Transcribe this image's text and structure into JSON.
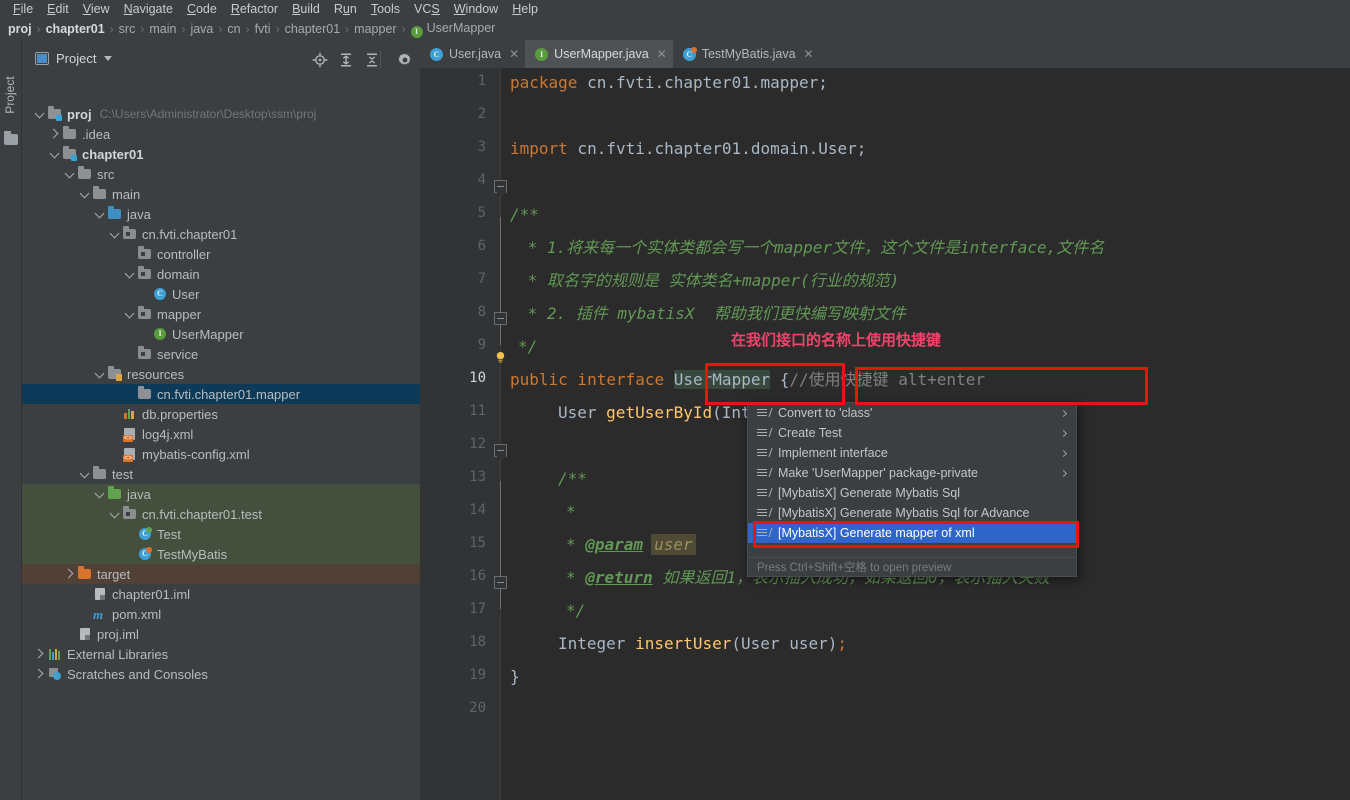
{
  "menubar": {
    "items": [
      {
        "label": "File",
        "mnemonic": "F"
      },
      {
        "label": "Edit",
        "mnemonic": "E"
      },
      {
        "label": "View",
        "mnemonic": "V"
      },
      {
        "label": "Navigate",
        "mnemonic": "N"
      },
      {
        "label": "Code",
        "mnemonic": "C"
      },
      {
        "label": "Refactor",
        "mnemonic": "R"
      },
      {
        "label": "Build",
        "mnemonic": "B"
      },
      {
        "label": "Run",
        "mnemonic": "u"
      },
      {
        "label": "Tools",
        "mnemonic": "T"
      },
      {
        "label": "VCS",
        "mnemonic": "S"
      },
      {
        "label": "Window",
        "mnemonic": "W"
      },
      {
        "label": "Help",
        "mnemonic": "H"
      }
    ]
  },
  "breadcrumb": {
    "items": [
      {
        "label": "proj",
        "bold": true,
        "icon": null
      },
      {
        "label": "chapter01",
        "bold": true,
        "icon": null
      },
      {
        "label": "src",
        "bold": false,
        "icon": null
      },
      {
        "label": "main",
        "bold": false,
        "icon": null
      },
      {
        "label": "java",
        "bold": false,
        "icon": null
      },
      {
        "label": "cn",
        "bold": false,
        "icon": null
      },
      {
        "label": "fvti",
        "bold": false,
        "icon": null
      },
      {
        "label": "chapter01",
        "bold": false,
        "icon": null
      },
      {
        "label": "mapper",
        "bold": false,
        "icon": null
      },
      {
        "label": "UserMapper",
        "bold": false,
        "icon": "interface-icon"
      }
    ],
    "separator": "›"
  },
  "left_strip": {
    "tab_label": "Project"
  },
  "project_panel": {
    "title": "Project",
    "toolbar": [
      {
        "name": "locate-file-icon"
      },
      {
        "name": "expand-all-icon"
      },
      {
        "name": "collapse-all-icon"
      },
      {
        "name": "settings-gear-icon"
      },
      {
        "name": "hide-panel-icon"
      }
    ],
    "tree": [
      {
        "indent": 0,
        "chev": "down",
        "icon": "module-folder",
        "label": "proj",
        "bold": true,
        "path": "C:\\Users\\Administrator\\Desktop\\ssm\\proj",
        "state": "normal"
      },
      {
        "indent": 1,
        "chev": "right",
        "icon": "folder-grey",
        "label": ".idea",
        "bold": false,
        "path": "",
        "state": "normal"
      },
      {
        "indent": 1,
        "chev": "down",
        "icon": "module-folder",
        "label": "chapter01",
        "bold": true,
        "path": "",
        "state": "normal"
      },
      {
        "indent": 2,
        "chev": "down",
        "icon": "folder-grey",
        "label": "src",
        "bold": false,
        "path": "",
        "state": "normal"
      },
      {
        "indent": 3,
        "chev": "down",
        "icon": "folder-grey",
        "label": "main",
        "bold": false,
        "path": "",
        "state": "normal"
      },
      {
        "indent": 4,
        "chev": "down",
        "icon": "folder-blue",
        "label": "java",
        "bold": false,
        "path": "",
        "state": "normal"
      },
      {
        "indent": 5,
        "chev": "down",
        "icon": "package",
        "label": "cn.fvti.chapter01",
        "bold": false,
        "path": "",
        "state": "normal"
      },
      {
        "indent": 6,
        "chev": "none",
        "icon": "package",
        "label": "controller",
        "bold": false,
        "path": "",
        "state": "normal"
      },
      {
        "indent": 6,
        "chev": "down",
        "icon": "package",
        "label": "domain",
        "bold": false,
        "path": "",
        "state": "normal"
      },
      {
        "indent": 7,
        "chev": "none",
        "icon": "class",
        "label": "User",
        "bold": false,
        "path": "",
        "state": "normal"
      },
      {
        "indent": 6,
        "chev": "down",
        "icon": "package",
        "label": "mapper",
        "bold": false,
        "path": "",
        "state": "normal"
      },
      {
        "indent": 7,
        "chev": "none",
        "icon": "interface",
        "label": "UserMapper",
        "bold": false,
        "path": "",
        "state": "normal"
      },
      {
        "indent": 6,
        "chev": "none",
        "icon": "package",
        "label": "service",
        "bold": false,
        "path": "",
        "state": "normal"
      },
      {
        "indent": 4,
        "chev": "down",
        "icon": "resources-folder",
        "label": "resources",
        "bold": false,
        "path": "",
        "state": "normal"
      },
      {
        "indent": 6,
        "chev": "none",
        "icon": "folder-grey",
        "label": "cn.fvti.chapter01.mapper",
        "bold": false,
        "path": "",
        "state": "selected"
      },
      {
        "indent": 5,
        "chev": "none",
        "icon": "properties",
        "label": "db.properties",
        "bold": false,
        "path": "",
        "state": "normal"
      },
      {
        "indent": 5,
        "chev": "none",
        "icon": "xml",
        "label": "log4j.xml",
        "bold": false,
        "path": "",
        "state": "normal"
      },
      {
        "indent": 5,
        "chev": "none",
        "icon": "xml",
        "label": "mybatis-config.xml",
        "bold": false,
        "path": "",
        "state": "normal"
      },
      {
        "indent": 3,
        "chev": "down",
        "icon": "folder-grey",
        "label": "test",
        "bold": false,
        "path": "",
        "state": "normal"
      },
      {
        "indent": 4,
        "chev": "down",
        "icon": "folder-green",
        "label": "java",
        "bold": false,
        "path": "",
        "state": "testsrc"
      },
      {
        "indent": 5,
        "chev": "down",
        "icon": "package",
        "label": "cn.fvti.chapter01.test",
        "bold": false,
        "path": "",
        "state": "testsrc"
      },
      {
        "indent": 6,
        "chev": "none",
        "icon": "class-test",
        "label": "Test",
        "bold": false,
        "path": "",
        "state": "testsrc"
      },
      {
        "indent": 6,
        "chev": "none",
        "icon": "class-test2",
        "label": "TestMyBatis",
        "bold": false,
        "path": "",
        "state": "testsrc"
      },
      {
        "indent": 2,
        "chev": "right",
        "icon": "folder-orange",
        "label": "target",
        "bold": false,
        "path": "",
        "state": "target"
      },
      {
        "indent": 3,
        "chev": "none",
        "icon": "iml",
        "label": "chapter01.iml",
        "bold": false,
        "path": "",
        "state": "normal"
      },
      {
        "indent": 3,
        "chev": "none",
        "icon": "maven",
        "label": "pom.xml",
        "bold": false,
        "path": "",
        "state": "normal"
      },
      {
        "indent": 2,
        "chev": "none",
        "icon": "iml",
        "label": "proj.iml",
        "bold": false,
        "path": "",
        "state": "normal"
      },
      {
        "indent": 0,
        "chev": "right",
        "icon": "libraries",
        "label": "External Libraries",
        "bold": false,
        "path": "",
        "state": "normal"
      },
      {
        "indent": 0,
        "chev": "right",
        "icon": "scratches",
        "label": "Scratches and Consoles",
        "bold": false,
        "path": "",
        "state": "normal"
      }
    ]
  },
  "editor": {
    "tabs": [
      {
        "label": "User.java",
        "icon": "class",
        "active": false
      },
      {
        "label": "UserMapper.java",
        "icon": "interface",
        "active": true
      },
      {
        "label": "TestMyBatis.java",
        "icon": "class-test",
        "active": false
      }
    ],
    "line_numbers": [
      1,
      2,
      3,
      4,
      5,
      6,
      7,
      8,
      9,
      10,
      11,
      12,
      13,
      14,
      15,
      16,
      17,
      18,
      19,
      20
    ],
    "current_line": 10,
    "code_lines": [
      {
        "n": 1,
        "text": "package cn.fvti.chapter01.mapper;"
      },
      {
        "n": 2,
        "text": ""
      },
      {
        "n": 3,
        "text": "import cn.fvti.chapter01.domain.User;"
      },
      {
        "n": 4,
        "text": ""
      },
      {
        "n": 5,
        "text": "/**"
      },
      {
        "n": 6,
        "text": " * 1.将来每一个实体类都会写一个mapper文件，这个文件是interface,文件名"
      },
      {
        "n": 7,
        "text": " * 取名字的规则是 实体类名+mapper(行业的规范)"
      },
      {
        "n": 8,
        "text": " * 2. 插件 mybatisX  帮助我们更快编写映射文件"
      },
      {
        "n": 9,
        "text": " */"
      },
      {
        "n": 10,
        "text": "public interface UserMapper {//使用快捷键 alt+enter"
      },
      {
        "n": 11,
        "text": "    User getUserById(Integer id);"
      },
      {
        "n": 12,
        "text": ""
      },
      {
        "n": 13,
        "text": "    /**"
      },
      {
        "n": 14,
        "text": "     *"
      },
      {
        "n": 15,
        "text": "     * @param user"
      },
      {
        "n": 16,
        "text": "     * @return 如果返回1，表示插入成功，如果返回0，表示插入失败"
      },
      {
        "n": 17,
        "text": "     */"
      },
      {
        "n": 18,
        "text": "    Integer insertUser(User user);"
      },
      {
        "n": 19,
        "text": "}"
      },
      {
        "n": 20,
        "text": ""
      }
    ],
    "tokens": {
      "l1_kw": "package",
      "l1_rest": " cn.fvti.chapter01.mapper;",
      "l3_kw": "import",
      "l3_rest": " cn.fvti.chapter01.domain.User;",
      "l5": "/**",
      "l6": " * 1.将来每一个实体类都会写一个mapper文件，这个文件是interface,文件名",
      "l7": " * 取名字的规则是 实体类名+mapper(行业的规范)",
      "l8": " * 2. 插件 mybatisX  帮助我们更快编写映射文件",
      "l9": "*/",
      "l10_kw": "public interface ",
      "l10_name": "UserMapper",
      "l10_brace": " {",
      "l10_cmt": "//使用快捷键 alt+enter",
      "l11_type": "User ",
      "l11_mth": "getUserById",
      "l11_rest": "(Integer id);",
      "l13": "/**",
      "l14": "*",
      "l15_star": "* ",
      "l15_tag": "@param",
      "l15_param": "user",
      "l16_star": "* ",
      "l16_tag": "@return",
      "l16_desc": " 如果返回1，表示插入成功，如果返回0，表示插入失败",
      "l17": "*/",
      "l18_type": "Integer ",
      "l18_mth": "insertUser",
      "l18_rest": "(User user)",
      "l18_sem": ";",
      "l19": "}"
    }
  },
  "intention_popup": {
    "items": [
      {
        "label": "Convert to 'class'",
        "submenu": true,
        "selected": false
      },
      {
        "label": "Create Test",
        "submenu": true,
        "selected": false
      },
      {
        "label": "Implement interface",
        "submenu": true,
        "selected": false
      },
      {
        "label": "Make 'UserMapper' package-private",
        "submenu": true,
        "selected": false
      },
      {
        "label": "[MybatisX] Generate Mybatis Sql",
        "submenu": false,
        "selected": false
      },
      {
        "label": "[MybatisX] Generate Mybatis Sql for Advance",
        "submenu": false,
        "selected": false
      },
      {
        "label": "[MybatisX] Generate mapper of xml",
        "submenu": false,
        "selected": true
      }
    ],
    "hint": "Press Ctrl+Shift+空格 to open preview"
  },
  "annotations": {
    "note_text": "在我们接口的名称上使用快捷键",
    "highlight_color": "#ee1111",
    "note_color": "#f0436a",
    "boxes": [
      {
        "name": "interface-name-box"
      },
      {
        "name": "comment-box"
      },
      {
        "name": "selected-action-box"
      }
    ]
  }
}
